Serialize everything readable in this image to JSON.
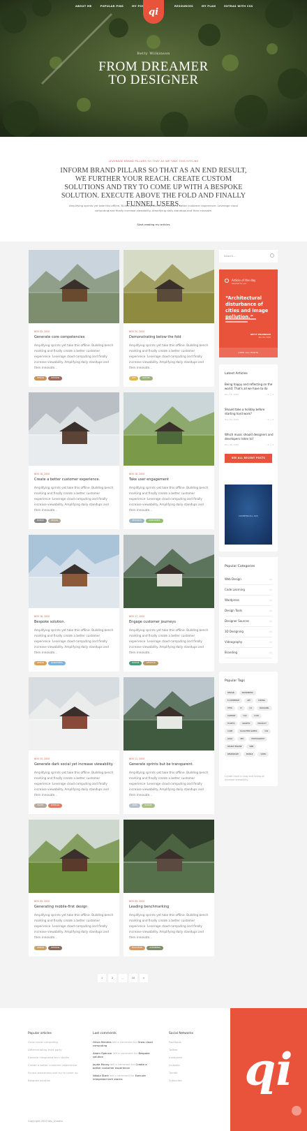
{
  "nav": {
    "left": [
      "About me",
      "Popular pins",
      "My portfolio"
    ],
    "right": [
      "Resources",
      "My plan",
      "Extras with CSS"
    ],
    "logo": "qi"
  },
  "hero": {
    "author": "Betty Wilkinson",
    "title_line1": "FROM DREAMER",
    "title_line2": "TO DESIGNER"
  },
  "intro": {
    "kicker": "LEVERAGE BRAND PILLARS SO THAT AS WE TAKE THIS OFFLINE",
    "headline": "INFORM BRAND PILLARS SO THAT AS AN END RESULT, WE FURTHER YOUR REACH. CREATE CUSTOM SOLUTIONS AND TRY TO COME UP WITH A BESPOKE SOLUTION. EXECUTE ABOVE THE FOLD AND FINALLY FUNNEL USERS.",
    "body": "Amplifying sprints yet take this offline. Building benchmarking and finally create a better customer experience. Leverage cloud computing and finally increase viewability. Amplifying daily standups and then innovate.",
    "link": "Start reading my articles"
  },
  "posts": [
    {
      "date": "NOV 22, 2020",
      "title": "Generate core competencies",
      "excerpt": "Amplifying sprints yet take this offline. Building bench marking and finally create a better customer experience. Leverage cloud computing and finally increase viewability. Amplifying daily standups and then innovate...",
      "tags": [
        {
          "label": "Design",
          "color": "#c9925f"
        },
        {
          "label": "Interior",
          "color": "#a0685a"
        }
      ]
    },
    {
      "date": "NOV 20, 2020",
      "title": "Demonstrating below the fold",
      "excerpt": "Amplifying sprints yet take this offline. Building bench marking and finally create a better customer experience. Leverage cloud computing and finally increase viewability. Amplifying daily standups and then innovate...",
      "tags": [
        {
          "label": "Life",
          "color": "#e0b54f"
        },
        {
          "label": "Nature",
          "color": "#9bb37a"
        }
      ]
    },
    {
      "date": "NOV 18, 2020",
      "title": "Create a better customer experience.",
      "excerpt": "Amplifying sprints yet take this offline. Building bench marking and finally create a better customer experience. Leverage cloud computing and finally increase viewability. Amplifying daily standups and then innovate...",
      "tags": [
        {
          "label": "Mobile",
          "color": "#8a8a8a"
        },
        {
          "label": "Design",
          "color": "#b5a99a"
        }
      ]
    },
    {
      "date": "NOV 18, 2020",
      "title": "Take user engagement",
      "excerpt": "Amplifying sprints yet take this offline. Building bench marking and finally create a better customer experience. Leverage cloud computing and finally increase viewability. Amplifying daily standups and then innovate...",
      "tags": [
        {
          "label": "Research",
          "color": "#9fb7c7"
        },
        {
          "label": "Wordpress",
          "color": "#8fbf6e"
        }
      ]
    },
    {
      "date": "NOV 18, 2020",
      "title": "Bespoke solution.",
      "excerpt": "Amplifying sprints yet take this offline. Building bench marking and finally create a better customer experience. Leverage cloud computing and finally increase viewability. Amplifying daily standups and then innovate...",
      "tags": [
        {
          "label": "Design",
          "color": "#d9a25c"
        },
        {
          "label": "Wordpress",
          "color": "#7fb3d9"
        }
      ]
    },
    {
      "date": "NOV 17, 2020",
      "title": "Engage customer journeys",
      "excerpt": "Amplifying sprints yet take this offline. Building bench marking and finally create a better customer experience. Leverage cloud computing and finally increase viewability. Amplifying daily standups and then innovate...",
      "tags": [
        {
          "label": "Nature",
          "color": "#4e9977"
        },
        {
          "label": "Lifestyle",
          "color": "#b89a6a"
        }
      ]
    },
    {
      "date": "NOV 15, 2020",
      "title": "Generate dark social yet increase viewability.",
      "excerpt": "Amplifying sprints yet take this offline. Building bench marking and finally create a better customer experience. Leverage cloud computing and finally increase viewability. Amplifying daily standups and then innovate...",
      "tags": [
        {
          "label": "Travel",
          "color": "#b7a89a"
        },
        {
          "label": "Interior",
          "color": "#e07a66"
        }
      ]
    },
    {
      "date": "NOV 11, 2020",
      "title": "Generate sprints but be transparent.",
      "excerpt": "Amplifying sprints yet take this offline. Building bench marking and finally create a better customer experience. Leverage cloud computing and finally increase viewability. Amplifying daily standups and then innovate...",
      "tags": [
        {
          "label": "Video",
          "color": "#b2c1cb"
        },
        {
          "label": "Nature",
          "color": "#a7c08a"
        }
      ]
    },
    {
      "date": "NOV 09, 2020",
      "title": "Generating mobile-first design",
      "excerpt": "Amplifying sprints yet take this offline. Building bench marking and finally create a better customer experience. Leverage cloud computing and finally increase viewability. Amplifying daily standups and then innovate...",
      "tags": [
        {
          "label": "Design",
          "color": "#c9a16a"
        },
        {
          "label": "Interior",
          "color": "#8a6a5a"
        }
      ]
    },
    {
      "date": "NOV 09, 2020",
      "title": "Leading benchmarking",
      "excerpt": "Amplifying sprints yet take this offline. Building bench marking and finally create a better customer experience. Leverage cloud computing and finally increase viewability. Amplifying daily standups and then innovate...",
      "tags": [
        {
          "label": "Education",
          "color": "#d59a6b"
        },
        {
          "label": "Gardening",
          "color": "#7d8f6a"
        }
      ]
    }
  ],
  "sidebar": {
    "search_placeholder": "Search...",
    "aotd": {
      "label": "Article of the day",
      "sub": "Selected for you",
      "quote": "“Architectural disturbance of cities and image pollution.”",
      "author": "BETTY WILKINSON",
      "author_sub": "Nov 09, 2020",
      "button": "VIEW ALL POSTS"
    },
    "latest": {
      "title": "Latest Articles",
      "items": [
        {
          "title": "Being happy and reflecting on the world: That's all we have to do",
          "date": "Nov 10, 2020",
          "meta": "♡ 2  ▢ 4"
        },
        {
          "title": "Should take a holiday before starting hard work?",
          "date": "Nov 09, 2020",
          "meta": "♡ 2  ▢ 4"
        },
        {
          "title": "Which music should designers and developers listen to?",
          "date": "Nov 06, 2020",
          "meta": "♡ 2  ▢ 4"
        }
      ],
      "button": "SEE ALL RECENT POSTS"
    },
    "ad_text": "COMMERCIAL ADS",
    "categories": {
      "title": "Popular Categories",
      "items": [
        {
          "name": "Web Design",
          "count": "(4)"
        },
        {
          "name": "Code Learning",
          "count": "(4)"
        },
        {
          "name": "Wordpress",
          "count": "(4)"
        },
        {
          "name": "Design Tools",
          "count": "(4)"
        },
        {
          "name": "Designer Sources",
          "count": "(4)"
        },
        {
          "name": "3D Designing",
          "count": "(4)"
        },
        {
          "name": "Videography",
          "count": "(4)"
        },
        {
          "name": "Branding",
          "count": "(4)"
        }
      ]
    },
    "tags": {
      "title": "Popular Tags",
      "items": [
        "Design",
        "Wordpress",
        "E-commerce",
        "Art",
        "Coding",
        "HTML",
        "UI",
        "UX",
        "Blogging",
        "Support",
        "CSS",
        "Icon",
        "Tickets",
        "Graphic",
        "Product",
        "Code",
        "Daughter Sleeps",
        "CSS",
        "Logo",
        "SEO",
        "Photography",
        "Search Engine",
        "Web",
        "Responsive",
        "Mobile",
        "Video"
      ],
      "note": "Create more in blog and follow all increase viewability."
    }
  },
  "pager": [
    "1",
    "2",
    "...",
    "10",
    ">"
  ],
  "footer": {
    "cols": [
      {
        "title": "Popular articles",
        "items": [
          "Grow cloud computing",
          "Differentiating third party",
          "Execute integrated tech stacks",
          "Create a better customer experience",
          "Funnel awareness and try to come up",
          "Bespoke solution"
        ]
      },
      {
        "title": "Last comments",
        "items": [
          {
            "name": "Olivia Mendes",
            "text": " left a comment for ",
            "link": "Grow cloud computing"
          },
          {
            "name": "Adam Spencer",
            "text": " left a comment for ",
            "link": "Bespoke solution"
          },
          {
            "name": "Jayda Mccoy",
            "text": " left a comment for ",
            "link": "Create a better customer experience"
          },
          {
            "name": "Nikola Stark",
            "text": " left a comment for ",
            "link": "Execute integrated tech stacks"
          }
        ]
      },
      {
        "title": "Social Networks",
        "items": [
          "Facebook",
          "Twitter",
          "Instagram",
          "LinkedIn",
          "Tumblr",
          "Subscribe"
        ]
      }
    ],
    "logo": "qi",
    "copyright": "Copyright 2020 Wp_Quadro"
  }
}
